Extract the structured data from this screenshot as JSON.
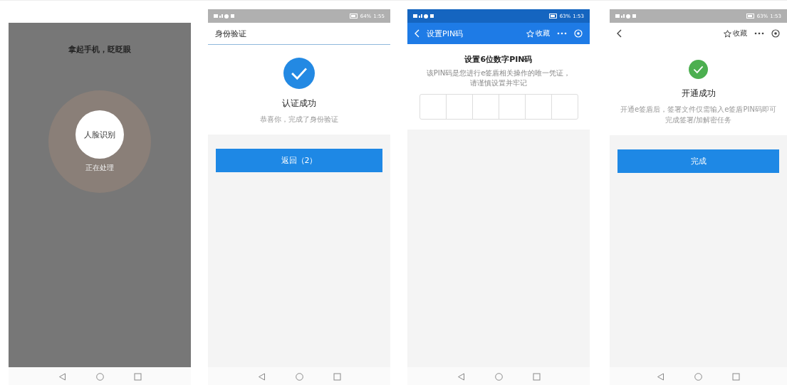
{
  "screens": [
    {
      "kind": "face",
      "prompt": "拿起手机，眨眨眼",
      "label": "人脸识别",
      "progress": "正在处理"
    },
    {
      "kind": "verified",
      "status_bar": {
        "battery": "64%",
        "time": "1:55"
      },
      "header": {
        "title": "身份验证"
      },
      "title": "认证成功",
      "message": "恭喜你，完成了身份验证",
      "button": "返回（2）"
    },
    {
      "kind": "pin",
      "status_bar": {
        "battery": "63%",
        "time": "1:53"
      },
      "header": {
        "title": "设置PIN码",
        "favorite": "收藏"
      },
      "title": "设置6位数字PIN码",
      "message": "该PIN码是您进行e签盾相关操作的唯一凭证，请谨慎设置并牢记"
    },
    {
      "kind": "activated",
      "status_bar": {
        "battery": "63%",
        "time": "1:53"
      },
      "header": {
        "favorite": "收藏"
      },
      "title": "开通成功",
      "message": "开通e签盾后，签署文件仅需输入e签盾PIN码即可完成签署/加解密任务",
      "button": "完成"
    }
  ]
}
